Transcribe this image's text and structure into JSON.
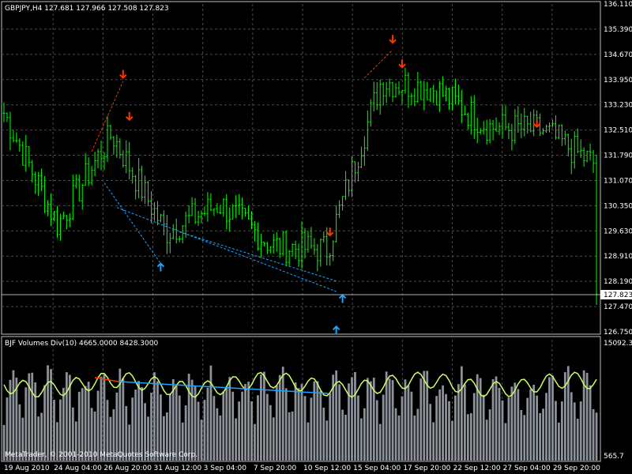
{
  "main_chart": {
    "title": "GBPJPY,H4  127.681 127.966 127.508 127.823",
    "price_ticks": [
      "136.110",
      "135.390",
      "134.670",
      "133.950",
      "133.230",
      "132.510",
      "131.790",
      "131.070",
      "130.350",
      "129.630",
      "128.910",
      "128.190",
      "127.470",
      "126.750"
    ],
    "current_price": "127.823"
  },
  "sub_chart": {
    "title": "BJF Volumes Div(10) 4665.0000 8428.3000",
    "scale_top": "15092.3",
    "scale_bottom": "565.7",
    "footer": "MetaTrader, © 2001-2010 MetaQuotes Software Corp."
  },
  "time_ticks": [
    "19 Aug 2010",
    "24 Aug 04:00",
    "26 Aug 20:00",
    "31 Aug 12:00",
    "3 Sep 04:00",
    "7 Sep 20:00",
    "10 Sep 12:00",
    "15 Sep 04:00",
    "17 Sep 20:00",
    "22 Sep 12:00",
    "27 Sep 04:00",
    "29 Sep 20:00"
  ],
  "chart_data": [
    {
      "type": "line",
      "title": "GBPJPY,H4",
      "ylim": [
        126.75,
        136.11
      ],
      "x": [
        "19 Aug 2010",
        "24 Aug 04:00",
        "26 Aug 20:00",
        "31 Aug 12:00",
        "3 Sep 04:00",
        "7 Sep 20:00",
        "10 Sep 12:00",
        "15 Sep 04:00",
        "17 Sep 20:00",
        "22 Sep 12:00",
        "27 Sep 04:00",
        "29 Sep 20:00"
      ],
      "approx_close": [
        133.0,
        129.8,
        132.4,
        129.6,
        130.4,
        129.2,
        129.1,
        133.9,
        133.7,
        132.6,
        132.5,
        131.5
      ],
      "last_close": 127.823,
      "colors": {
        "bars": "#00ff00",
        "down_arrow": "#ff3300",
        "up_arrow": "#1aa3ff"
      }
    },
    {
      "type": "bar",
      "title": "BJF Volumes Div(10)",
      "ylim": [
        565.7,
        15092.3
      ],
      "values_shown": [
        4665.0,
        8428.3
      ],
      "colors": {
        "volume": "#8c919a",
        "line": "#ccff66",
        "div_high": "#ff3300",
        "div_low": "#1aa3ff"
      }
    }
  ]
}
